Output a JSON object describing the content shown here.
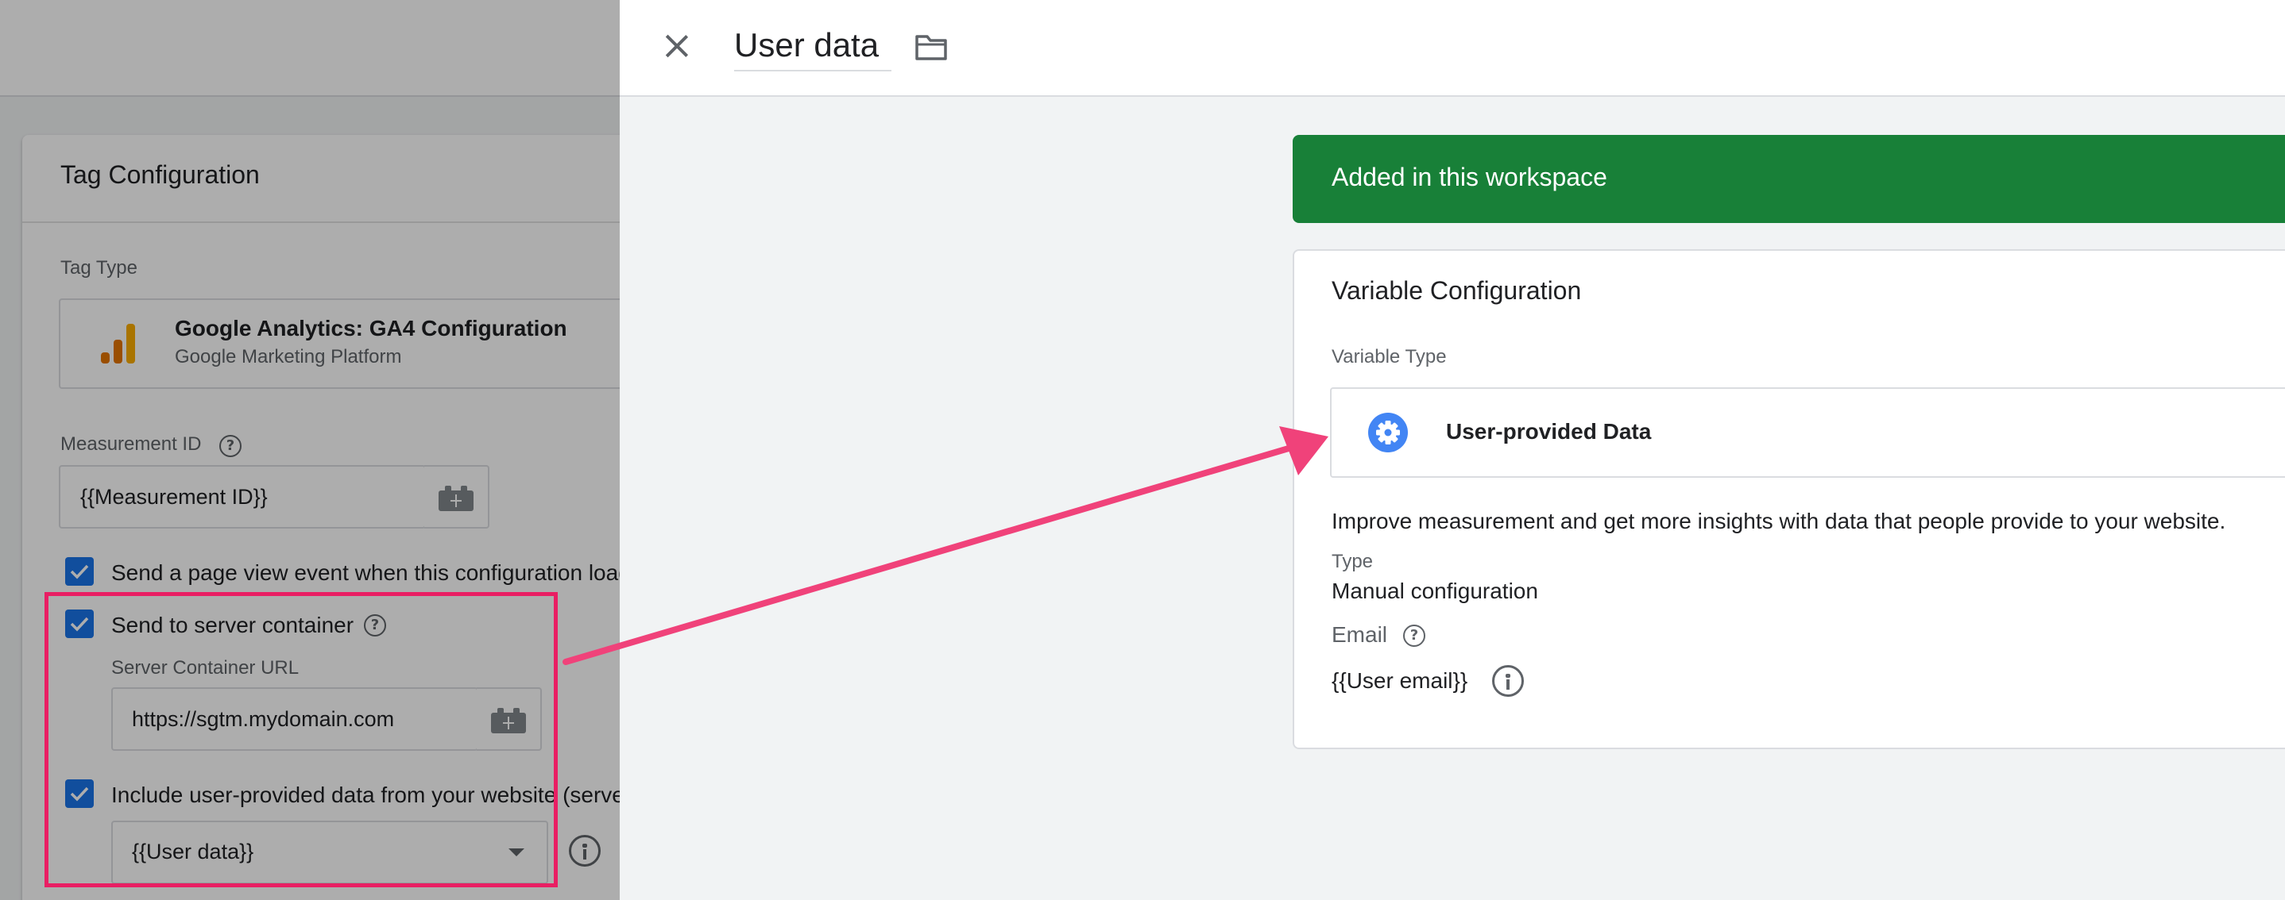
{
  "background_page": {
    "tag_config": {
      "title": "Tag Configuration",
      "tag_type_label": "Tag Type",
      "tag_type_name": "Google Analytics: GA4 Configuration",
      "tag_type_sub": "Google Marketing Platform",
      "measurement_id_label": "Measurement ID",
      "measurement_id_value": "{{Measurement ID}}",
      "send_page_view_label": "Send a page view event when this configuration load",
      "send_to_server_label": "Send to server container",
      "server_url_label": "Server Container URL",
      "server_url_value": "https://sgtm.mydomain.com",
      "include_user_data_label": "Include user-provided data from your website (serve",
      "user_data_value": "{{User data}}"
    }
  },
  "panel": {
    "title": "User data",
    "banner_text": "Added in this workspace",
    "variable_config": {
      "title": "Variable Configuration",
      "variable_type_label": "Variable Type",
      "variable_type_name": "User-provided Data",
      "description": "Improve measurement and get more insights with data that people provide to your website.",
      "type_label": "Type",
      "type_value": "Manual configuration",
      "email_label": "Email",
      "email_value": "{{User email}}"
    }
  },
  "colors": {
    "accent_blue": "#1a73e8",
    "banner_green": "#188038",
    "highlight_pink": "#e91e63"
  },
  "icons": [
    "close-icon",
    "folder-icon",
    "help-icon",
    "info-icon",
    "gear-icon",
    "variable-brick-icon",
    "ga-bars-icon",
    "checkbox-checked-icon",
    "dropdown-arrow-icon"
  ]
}
